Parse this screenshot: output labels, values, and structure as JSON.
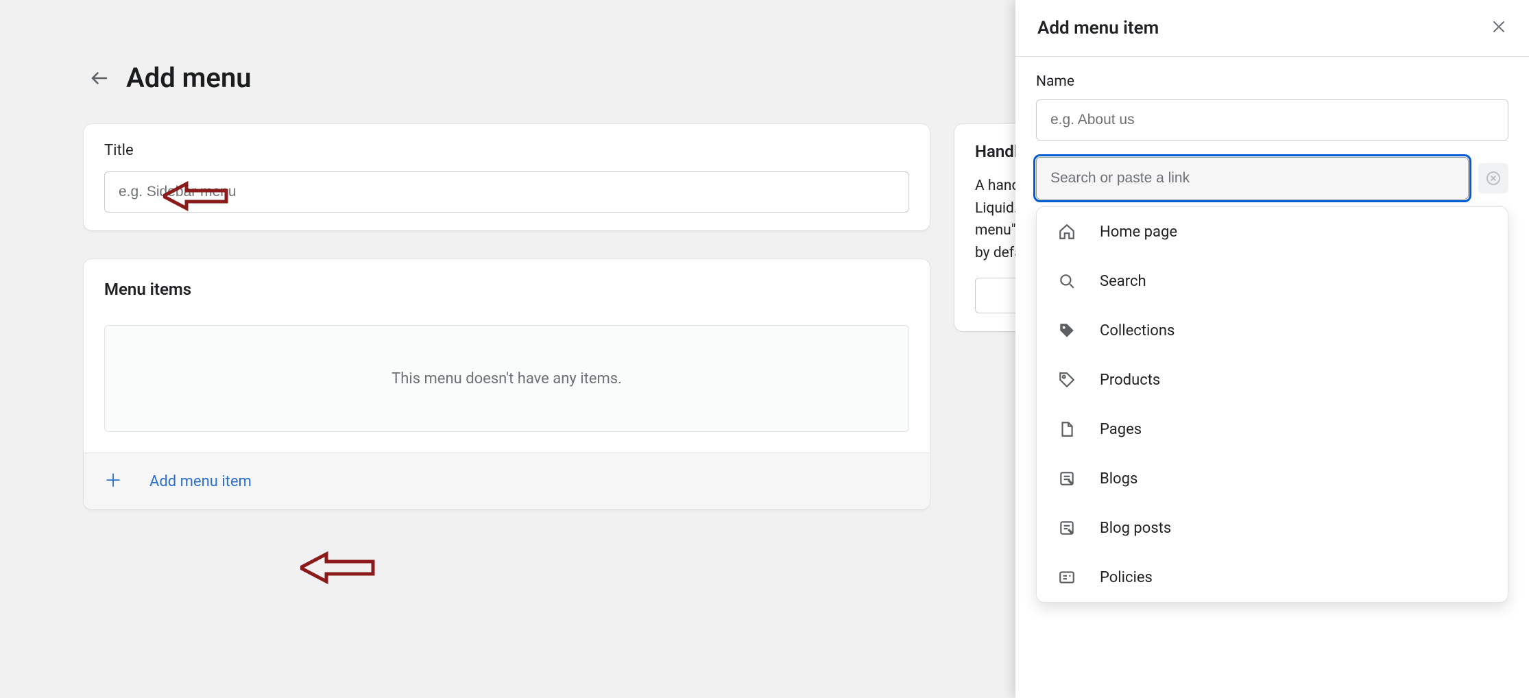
{
  "page": {
    "title": "Add menu"
  },
  "title_card": {
    "label": "Title",
    "placeholder": "e.g. Sidebar menu"
  },
  "menu_items_card": {
    "heading": "Menu items",
    "empty_text": "This menu doesn't have any items.",
    "add_label": "Add menu item"
  },
  "handle_card": {
    "heading": "Handle",
    "line1": "A handle is used to reference a menu in",
    "line2": "Liquid. It is also used for the \"main-",
    "line3": "menu\" and \"footer\" menus, to load them",
    "line4": "by default in a theme."
  },
  "panel": {
    "title": "Add menu item",
    "name_label": "Name",
    "name_placeholder": "e.g. About us",
    "link_placeholder": "Search or paste a link",
    "options": [
      {
        "icon": "home-icon",
        "label": "Home page"
      },
      {
        "icon": "search-icon",
        "label": "Search"
      },
      {
        "icon": "tag-icon",
        "label": "Collections"
      },
      {
        "icon": "tag-outline-icon",
        "label": "Products"
      },
      {
        "icon": "page-icon",
        "label": "Pages"
      },
      {
        "icon": "blog-icon",
        "label": "Blogs"
      },
      {
        "icon": "blog-post-icon",
        "label": "Blog posts"
      },
      {
        "icon": "policy-icon",
        "label": "Policies"
      }
    ]
  }
}
